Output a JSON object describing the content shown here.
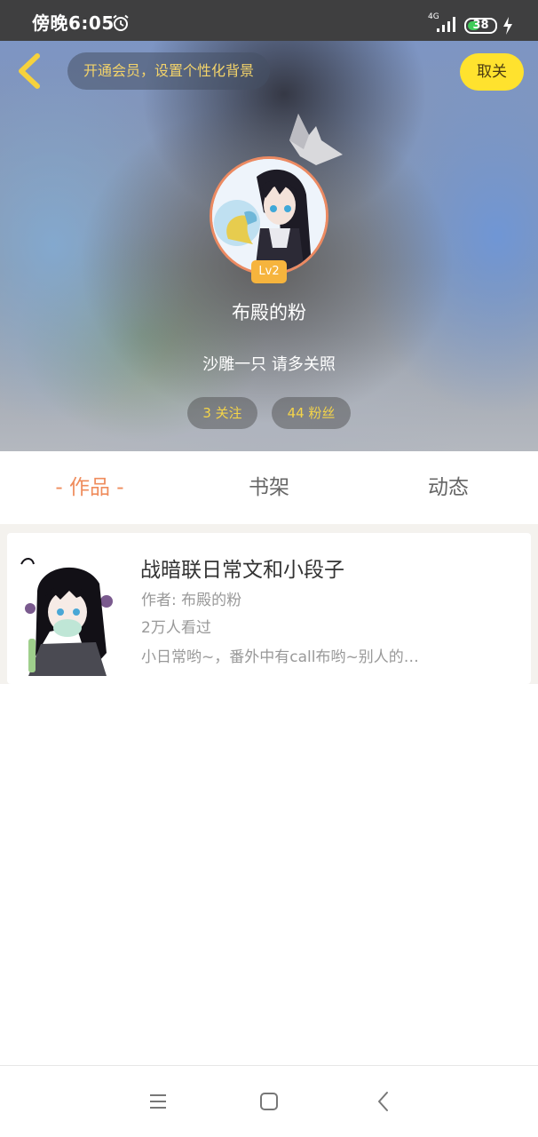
{
  "status_bar": {
    "time": "傍晚6:05",
    "network": "4G",
    "battery": "38",
    "battery_level": 0.38
  },
  "header": {
    "vip_banner": "开通会员，设置个性化背景",
    "unfollow_label": "取关",
    "back_icon": "chevron-left-icon",
    "accent_color": "#ffe22e"
  },
  "profile": {
    "level": "Lv2",
    "name": "布殿的粉",
    "bio": "沙雕一只 请多关照",
    "following": "3 关注",
    "fans": "44 粉丝"
  },
  "tabs": {
    "works": "- 作品 -",
    "shelf": "书架",
    "feed": "动态",
    "active_color": "#ef8c5c"
  },
  "works": [
    {
      "title": "战暗联日常文和小段子",
      "author": "作者: 布殿的粉",
      "views": "2万人看过",
      "description": "小日常哟~，番外中有call布哟~别人的…"
    }
  ],
  "nav_bar": {
    "icons": [
      "menu-icon",
      "home-square-icon",
      "back-triangle-icon"
    ]
  }
}
